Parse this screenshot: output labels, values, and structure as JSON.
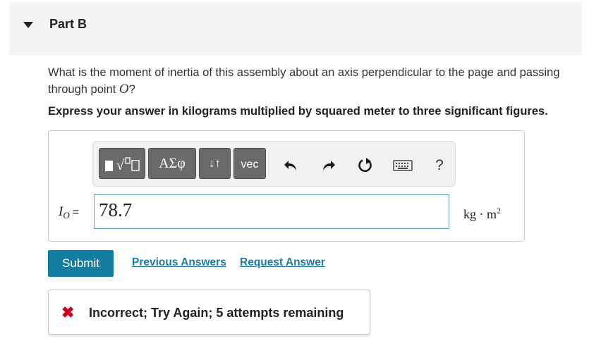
{
  "part": {
    "title": "Part B",
    "caret_icon": "caret-down-icon"
  },
  "question": {
    "text_before": "What is the moment of inertia of this assembly about an axis perpendicular to the page and passing through point ",
    "point": "O",
    "text_after": "?"
  },
  "instruction": "Express your answer in kilograms multiplied by squared meter to three significant figures.",
  "toolbar": {
    "buttons": [
      {
        "name": "templates-button",
        "label": "▮√▯"
      },
      {
        "name": "greek-symbols-button",
        "label": "ΑΣφ"
      },
      {
        "name": "arrows-button",
        "label": "↓↑"
      },
      {
        "name": "vector-button",
        "label": "vec"
      }
    ],
    "undo_icon": "undo-icon",
    "redo_icon": "redo-icon",
    "reset_icon": "reset-icon",
    "keyboard_icon": "keyboard-icon",
    "help_label": "?"
  },
  "answer": {
    "variable": "I",
    "subscript": "O",
    "equals": "=",
    "value": "78.7",
    "units_base": "kg · m",
    "units_exp": "2"
  },
  "actions": {
    "submit_label": "Submit",
    "previous_answers_label": "Previous Answers",
    "request_answer_label": "Request Answer"
  },
  "feedback": {
    "icon": "x-icon",
    "text": "Incorrect; Try Again; 5 attempts remaining",
    "color": "#d0021b"
  },
  "colors": {
    "accent": "#137ea2",
    "link": "#1b7aa6",
    "input_border": "#5aa4b8"
  }
}
